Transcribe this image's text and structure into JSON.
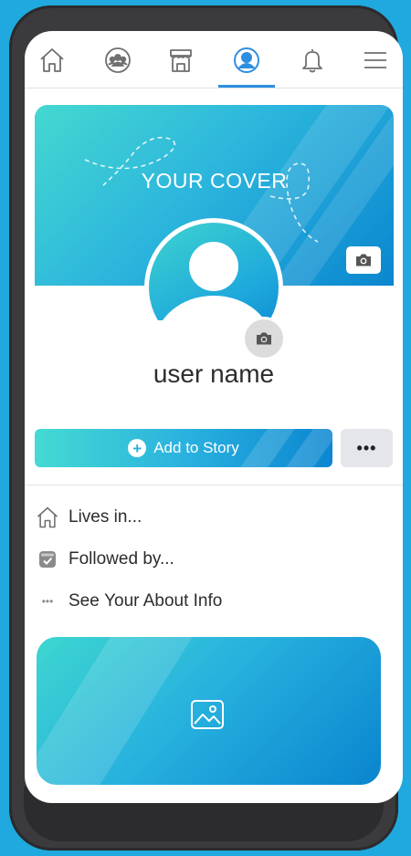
{
  "nav": {
    "items": [
      {
        "icon": "home-icon",
        "active": false
      },
      {
        "icon": "groups-icon",
        "active": false
      },
      {
        "icon": "marketplace-icon",
        "active": false
      },
      {
        "icon": "profile-icon",
        "active": true
      },
      {
        "icon": "bell-icon",
        "active": false
      },
      {
        "icon": "menu-icon",
        "active": false
      }
    ]
  },
  "cover": {
    "text": "YOUR COVER",
    "camera_icon": "camera-icon"
  },
  "profile": {
    "user_name": "user name",
    "camera_icon": "camera-icon"
  },
  "actions": {
    "add_story_label": "Add to Story",
    "more_label": "•••"
  },
  "about": {
    "lives_in": "Lives in...",
    "followed_by": "Followed by...",
    "see_about_prefix": "See ",
    "see_about_rest": "Your About Info",
    "more_dots": "•••"
  },
  "photo_card": {
    "icon": "image-icon"
  },
  "colors": {
    "accent": "#2d8fe0",
    "gradient_start": "#45d8d0",
    "gradient_end": "#0a86cf",
    "background": "#1fa9df",
    "phone_frame": "#3b3b3d"
  }
}
